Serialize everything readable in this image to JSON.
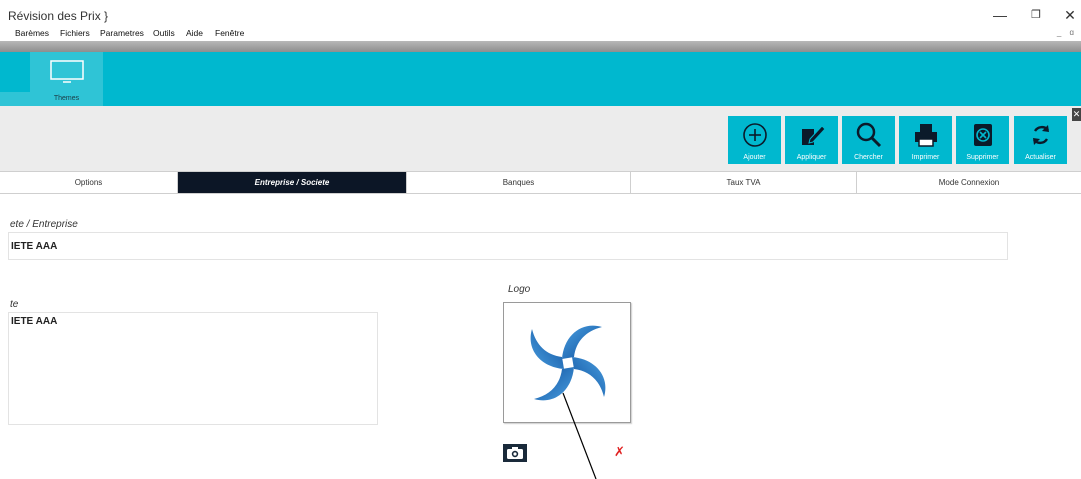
{
  "window": {
    "title": "Révision des Prix  }",
    "minimize_glyph": "—",
    "restore_glyph": "❐",
    "close_glyph": "✕"
  },
  "menu": {
    "items": [
      "Barèmes",
      "Fichiers",
      "Parametres",
      "Outils",
      "Aide",
      "Fenêtre"
    ],
    "right_controls": "_ ɑ"
  },
  "ribbon": {
    "themes_label": "Themes"
  },
  "toolbar": {
    "buttons": [
      {
        "label": "Ajouter",
        "icon": "plus-circle-icon"
      },
      {
        "label": "Appliquer",
        "icon": "edit-note-icon"
      },
      {
        "label": "Chercher",
        "icon": "search-icon"
      },
      {
        "label": "Imprimer",
        "icon": "printer-icon"
      },
      {
        "label": "Supprimer",
        "icon": "delete-box-icon"
      },
      {
        "label": "Actualiser",
        "icon": "refresh-icon"
      }
    ],
    "close_glyph": "✕"
  },
  "tabs": [
    {
      "label": "Options",
      "active": false
    },
    {
      "label": "Entreprise / Societe",
      "active": true
    },
    {
      "label": "Banques",
      "active": false
    },
    {
      "label": "Taux TVA",
      "active": false
    },
    {
      "label": "Mode Connexion",
      "active": false
    }
  ],
  "form": {
    "company_label": "ete / Entreprise",
    "company_value": "IETE AAA",
    "second_label": "te",
    "second_value": "IETE AAA",
    "logo_label": "Logo",
    "delete_glyph": "✗"
  },
  "colors": {
    "accent": "#00b8cf",
    "active_tab": "#0c1626",
    "delete": "#e02020"
  }
}
